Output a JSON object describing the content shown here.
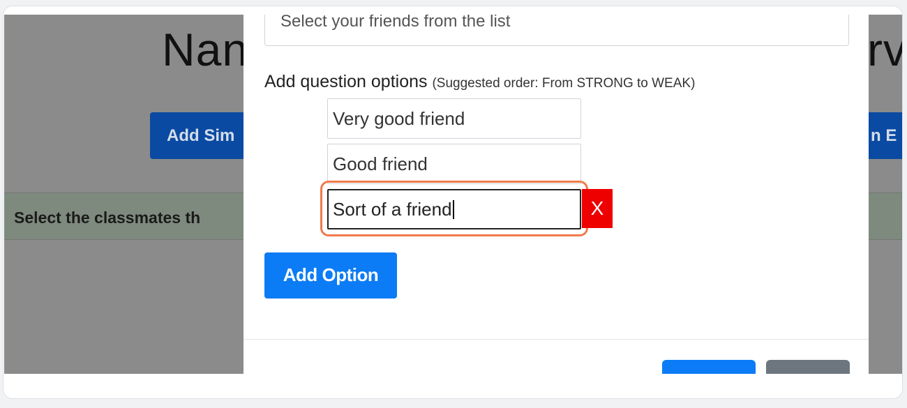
{
  "background": {
    "title_left": "Nan",
    "title_right": "rv",
    "button_left": "Add Sim",
    "button_right": "n E",
    "band_text": "Select the classmates th"
  },
  "modal": {
    "question_placeholder": "Select your friends from the list",
    "options_label": "Add question options",
    "options_hint": "(Suggested order: From STRONG to WEAK)",
    "options": [
      "Very good friend",
      "Good friend",
      "Sort of a friend"
    ],
    "remove_label": "X",
    "add_option_label": "Add Option"
  },
  "colors": {
    "primary": "#0b7cf5",
    "danger": "#ee0000",
    "highlight": "#f07a4a",
    "secondary": "#6d767e"
  }
}
